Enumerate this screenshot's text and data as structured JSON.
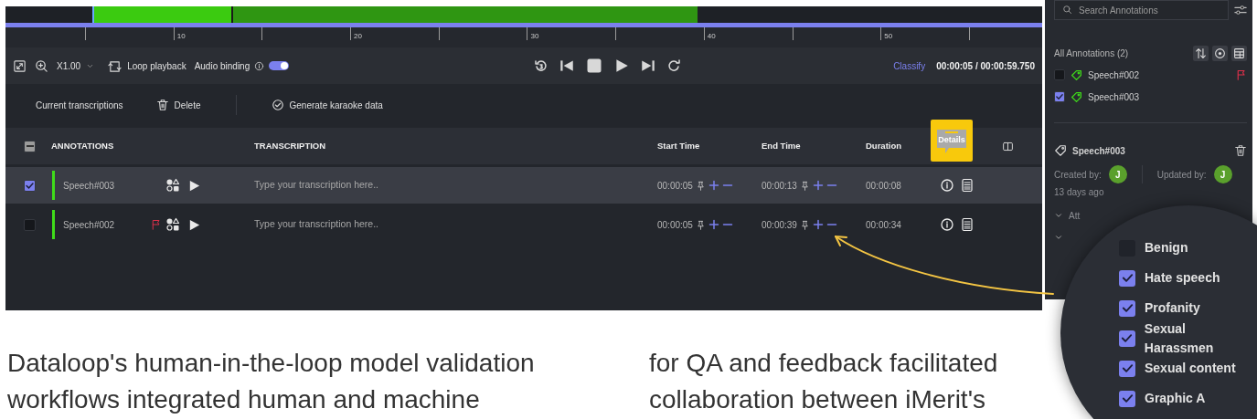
{
  "timeline": {
    "tick_labels": [
      "10",
      "20",
      "30",
      "40",
      "50"
    ]
  },
  "toolbar": {
    "zoom": "X1.00",
    "loop_label": "Loop playback",
    "audio_binding": {
      "label": "Audio binding",
      "on": true
    },
    "classify": "Classify",
    "time": "00:00:05 / 00:00:59.750"
  },
  "actions": [
    {
      "kind": "tab",
      "label": "Current transcriptions"
    },
    {
      "kind": "delete",
      "label": "Delete"
    },
    {
      "kind": "generate",
      "label": "Generate karaoke data"
    }
  ],
  "table": {
    "header_indeterminate": true,
    "columns": [
      {
        "label": "ANNOTATIONS",
        "highlighted": false
      },
      {
        "label": "TRANSCRIPTION",
        "highlighted": false
      },
      {
        "label": "Start Time",
        "highlighted": false
      },
      {
        "label": "End Time",
        "highlighted": false
      },
      {
        "label": "Duration",
        "highlighted": false
      },
      {
        "label": "Details",
        "highlighted": true
      }
    ],
    "rows": [
      {
        "name": "Speech#003",
        "selected": true,
        "checked": true,
        "flagged": false,
        "placeholder": "Type your transcription here..",
        "start": "00:00:05",
        "end": "00:00:13",
        "duration": "00:00:08"
      },
      {
        "name": "Speech#002",
        "selected": false,
        "checked": false,
        "flagged": true,
        "placeholder": "Type your transcription here..",
        "start": "00:00:05",
        "end": "00:00:39",
        "duration": "00:00:34"
      }
    ]
  },
  "sidebar": {
    "search_placeholder": "Search Annotations",
    "all_label": "All Annotations (2)",
    "items": [
      {
        "name": "Speech#002",
        "checked": false,
        "flagged": true
      },
      {
        "name": "Speech#003",
        "checked": true,
        "flagged": false
      }
    ],
    "detail": {
      "title": "Speech#003",
      "created_label": "Created by:",
      "created_initial": "J",
      "created_time": "13 days ago",
      "updated_label": "Updated by:",
      "updated_initial": "J",
      "section": "Att"
    }
  },
  "magnifier": {
    "items": [
      {
        "label": "Benign",
        "checked": false
      },
      {
        "label": "Hate speech",
        "checked": true
      },
      {
        "label": "Profanity",
        "checked": true
      },
      {
        "label": "Sexual Harassmen",
        "checked": true
      },
      {
        "label": "Sexual content",
        "checked": true
      },
      {
        "label": "Graphic A",
        "checked": true
      }
    ]
  },
  "article": {
    "paragraphs": [
      "Dataloop's human-in-the-loop model validation workflows integrated human and machine",
      "for QA and feedback facilitated collaboration between iMerit's"
    ]
  }
}
